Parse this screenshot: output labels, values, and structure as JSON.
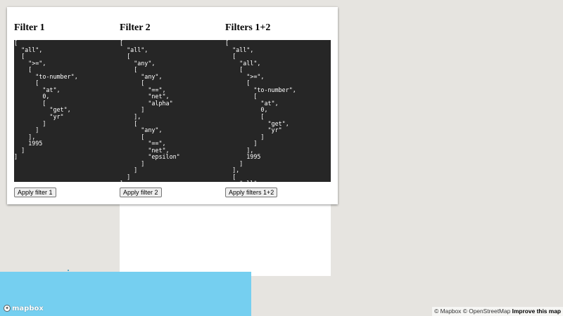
{
  "columns": [
    {
      "title": "Filter 1",
      "code": "[\n  \"all\",\n  [\n    \">=\",\n    [\n      \"to-number\",\n      [\n        \"at\",\n        0,\n        [\n          \"get\",\n          \"yr\"\n        ]\n      ]\n    ],\n    1995\n  ]\n]",
      "button": "Apply filter 1"
    },
    {
      "title": "Filter 2",
      "code": "[\n  \"all\",\n  [\n    \"any\",\n    [\n      \"any\",\n      [\n        \"==\",\n        \"net\",\n        \"alpha\"\n      ]\n    ],\n    [\n      \"any\",\n      [\n        \"==\",\n        \"net\",\n        \"epsilon\"\n      ]\n    ]\n  ]\n]",
      "button": "Apply filter 2"
    },
    {
      "title": "Filters 1+2",
      "code": "[\n  \"all\",\n  [\n    \"all\",\n    [\n      \">=\",\n      [\n        \"to-number\",\n        [\n          \"at\",\n          0,\n          [\n            \"get\",\n            \"yr\"\n          ]\n        ]\n      ],\n      1995\n    ]\n  ],\n  [\n    \"all\",",
      "button": "Apply filters 1+2"
    }
  ],
  "map": {
    "logo_text": "mapbox",
    "attribution": "© Mapbox © OpenStreetMap",
    "improve_link": "Improve this map",
    "colors": {
      "land": "#e6e4e0",
      "water": "#75cff0",
      "panel": "#ffffff",
      "code_bg": "#262626"
    }
  }
}
